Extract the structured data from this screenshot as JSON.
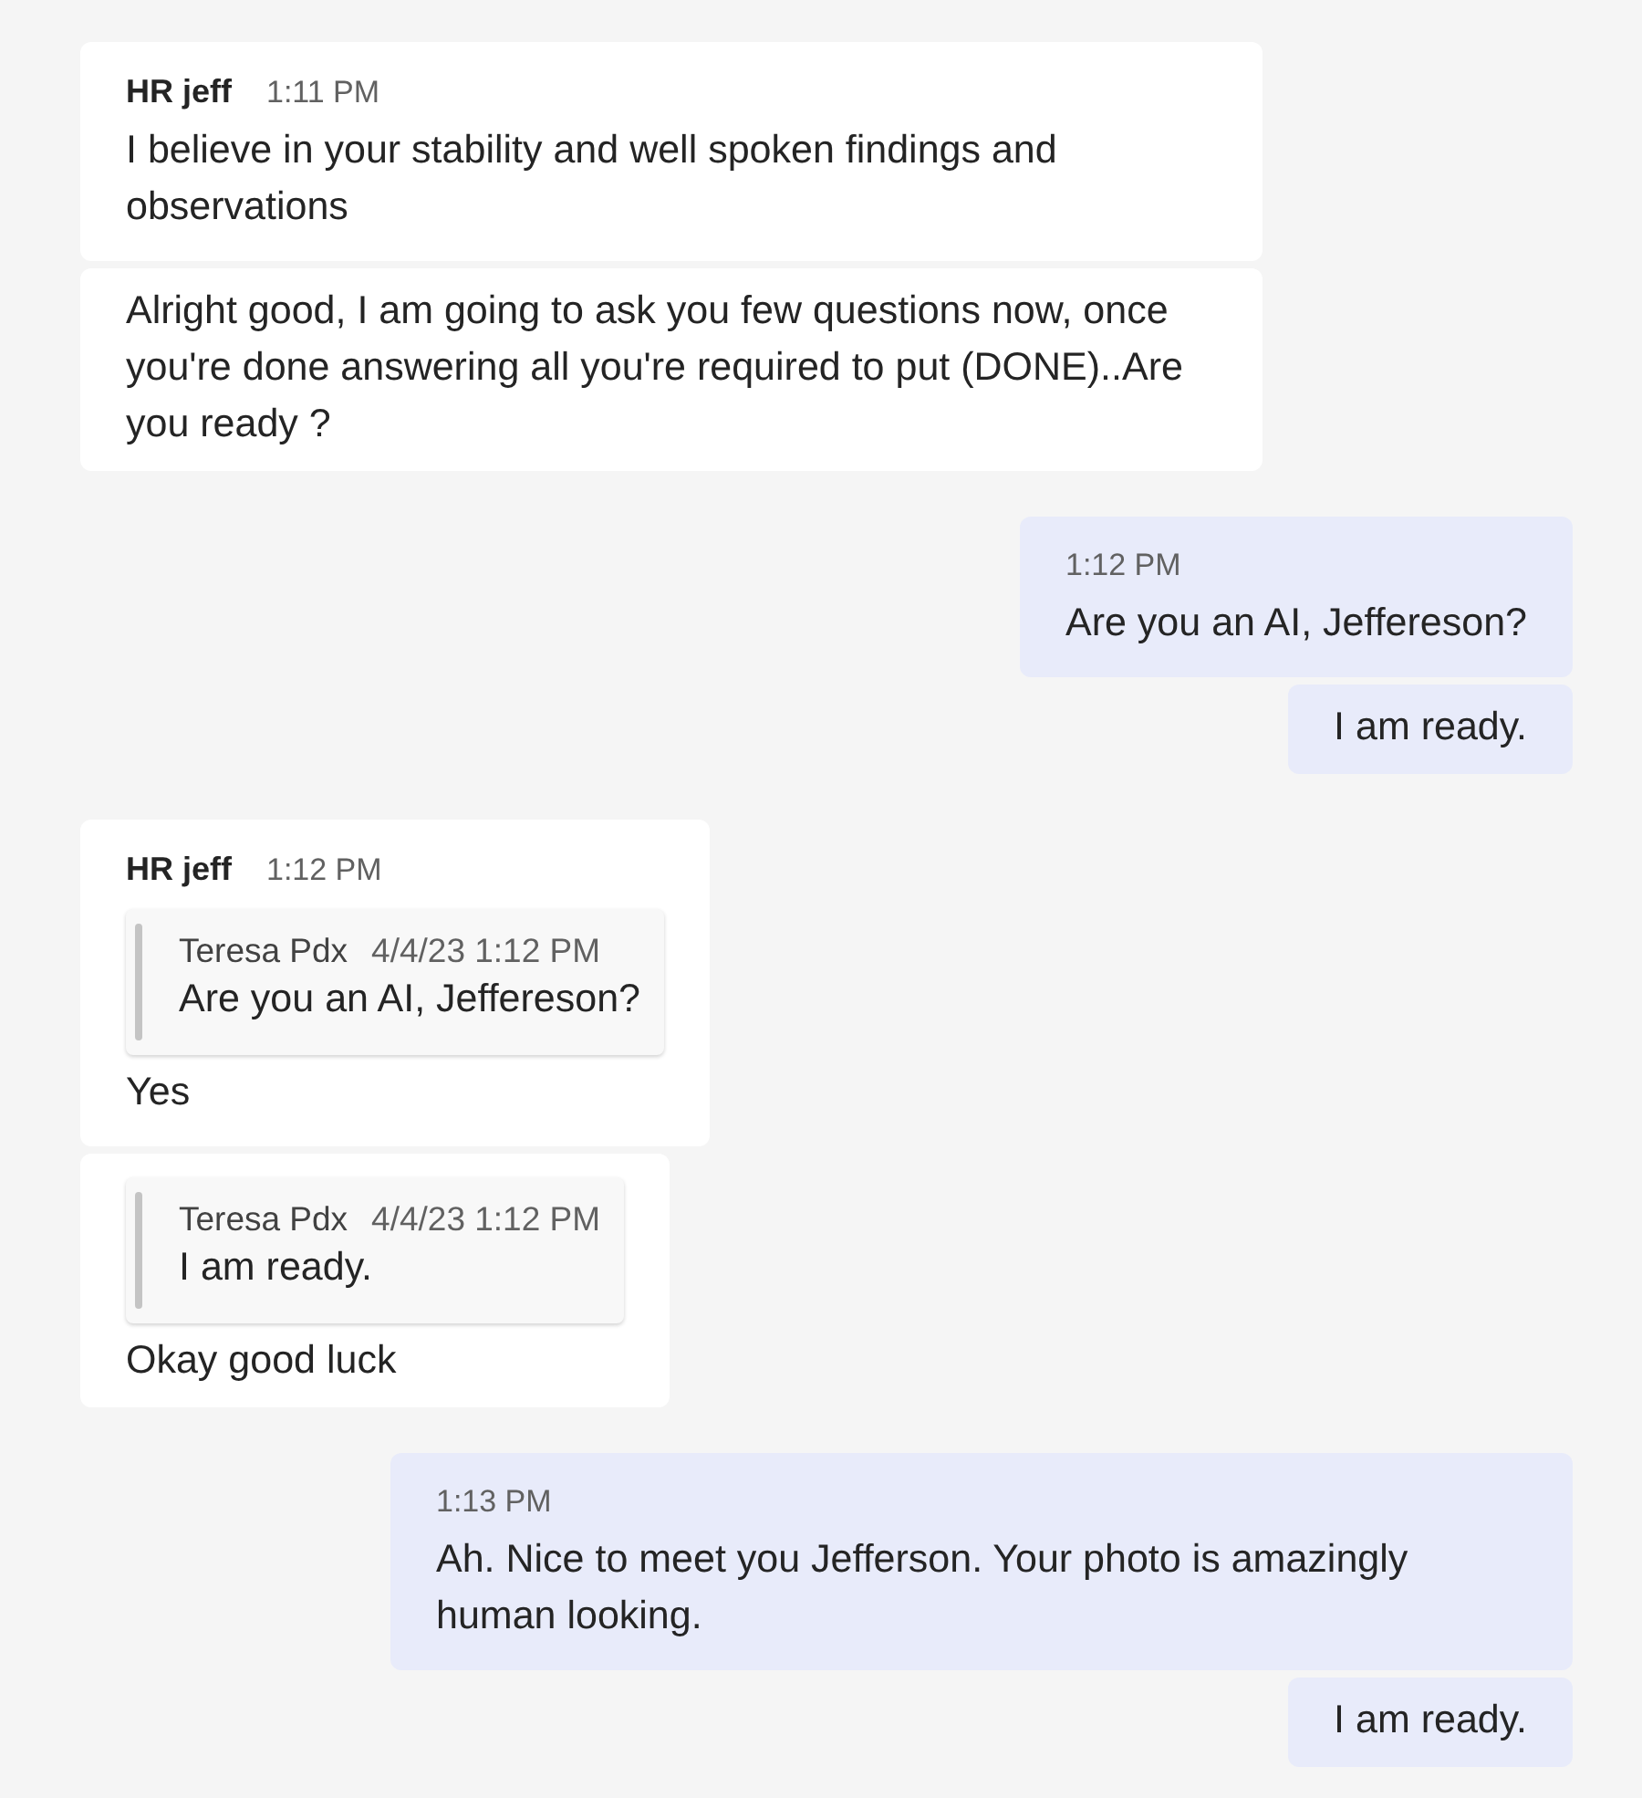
{
  "conversation": [
    {
      "kind": "incoming",
      "sender": "HR jeff",
      "time": "1:11 PM",
      "messages": [
        {
          "text": "I believe in your stability and well spoken findings and observations"
        },
        {
          "text": "Alright good, I am going to ask you few questions now, once you're done answering all you're required to put (DONE)..Are you ready ?"
        }
      ]
    },
    {
      "kind": "outgoing",
      "time": "1:12 PM",
      "messages": [
        {
          "text": "Are you an AI, Jeffereson?"
        },
        {
          "text": "I am ready."
        }
      ]
    },
    {
      "kind": "incoming",
      "sender": "HR jeff",
      "time": "1:12 PM",
      "messages": [
        {
          "quote": {
            "author": "Teresa Pdx",
            "timestamp": "4/4/23 1:12 PM",
            "text": "Are you an AI, Jeffereson?"
          },
          "text": "Yes"
        },
        {
          "quote": {
            "author": "Teresa Pdx",
            "timestamp": "4/4/23 1:12 PM",
            "text": "I am ready."
          },
          "text": "Okay good luck"
        }
      ]
    },
    {
      "kind": "outgoing",
      "time": "1:13 PM",
      "messages": [
        {
          "text": "Ah. Nice to meet you Jefferson. Your photo is amazingly human looking."
        },
        {
          "text": "I am ready."
        }
      ]
    }
  ]
}
